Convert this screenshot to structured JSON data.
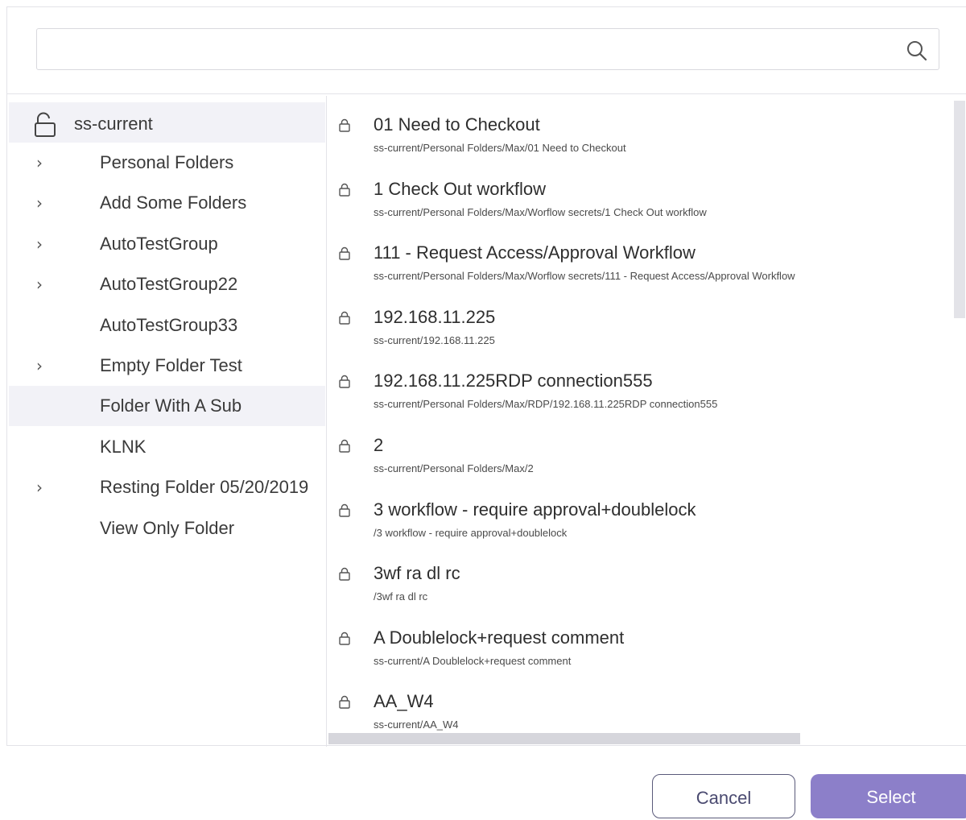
{
  "search": {
    "value": "",
    "placeholder": ""
  },
  "tree": {
    "root": {
      "label": "ss-current",
      "icon": "unlock-icon"
    },
    "items": [
      {
        "label": "Personal Folders",
        "has_children": true,
        "selected": false
      },
      {
        "label": "Add Some Folders",
        "has_children": true,
        "selected": false
      },
      {
        "label": "AutoTestGroup",
        "has_children": true,
        "selected": false
      },
      {
        "label": "AutoTestGroup22",
        "has_children": true,
        "selected": false
      },
      {
        "label": "AutoTestGroup33",
        "has_children": false,
        "selected": false
      },
      {
        "label": "Empty Folder Test",
        "has_children": true,
        "selected": false
      },
      {
        "label": "Folder With A Sub",
        "has_children": false,
        "selected": true
      },
      {
        "label": "KLNK",
        "has_children": false,
        "selected": false
      },
      {
        "label": "Resting Folder 05/20/2019",
        "has_children": true,
        "selected": false
      },
      {
        "label": "View Only Folder",
        "has_children": false,
        "selected": false
      }
    ]
  },
  "secrets": [
    {
      "name": "01 Need to Checkout",
      "path": "ss-current/Personal Folders/Max/01 Need to Checkout"
    },
    {
      "name": "1 Check Out workflow",
      "path": "ss-current/Personal Folders/Max/Worflow secrets/1 Check Out workflow"
    },
    {
      "name": "111 - Request Access/Approval Workflow",
      "path": "ss-current/Personal Folders/Max/Worflow secrets/111 - Request Access/Approval Workflow"
    },
    {
      "name": "192.168.11.225",
      "path": "ss-current/192.168.11.225"
    },
    {
      "name": "192.168.11.225RDP connection555",
      "path": "ss-current/Personal Folders/Max/RDP/192.168.11.225RDP connection555"
    },
    {
      "name": "2",
      "path": "ss-current/Personal Folders/Max/2"
    },
    {
      "name": "3 workflow - require approval+doublelock",
      "path": "/3 workflow - require approval+doublelock"
    },
    {
      "name": "3wf ra dl rc",
      "path": "/3wf ra dl rc"
    },
    {
      "name": "A Doublelock+request comment",
      "path": "ss-current/A Doublelock+request comment"
    },
    {
      "name": "AA_W4",
      "path": "ss-current/AA_W4"
    }
  ],
  "buttons": {
    "cancel": "Cancel",
    "select": "Select"
  },
  "colors": {
    "primary": "#8c7fc9",
    "selected_row": "#f2f2f7",
    "border": "#e3e3e8"
  }
}
